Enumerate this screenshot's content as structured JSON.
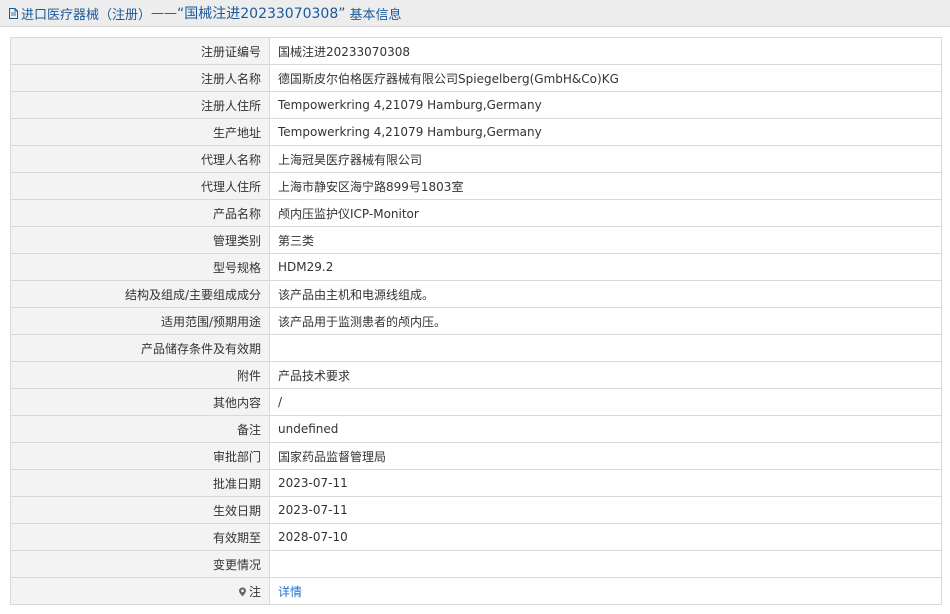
{
  "header": {
    "category": "进口医疗器械（注册）",
    "separator": "——",
    "reg_no_quoted": "“国械注进20233070308”",
    "suffix": "基本信息"
  },
  "rows": [
    {
      "label": "注册证编号",
      "value": "国械注进20233070308"
    },
    {
      "label": "注册人名称",
      "value": "德国斯皮尔伯格医疗器械有限公司Spiegelberg(GmbH&Co)KG"
    },
    {
      "label": "注册人住所",
      "value": "Tempowerkring 4,21079 Hamburg,Germany"
    },
    {
      "label": "生产地址",
      "value": "Tempowerkring 4,21079 Hamburg,Germany"
    },
    {
      "label": "代理人名称",
      "value": "上海冠昊医疗器械有限公司"
    },
    {
      "label": "代理人住所",
      "value": "上海市静安区海宁路899号1803室"
    },
    {
      "label": "产品名称",
      "value": "颅内压监护仪ICP-Monitor"
    },
    {
      "label": "管理类别",
      "value": "第三类"
    },
    {
      "label": "型号规格",
      "value": "HDM29.2"
    },
    {
      "label": "结构及组成/主要组成成分",
      "value": "该产品由主机和电源线组成。"
    },
    {
      "label": "适用范围/预期用途",
      "value": "该产品用于监测患者的颅内压。"
    },
    {
      "label": "产品储存条件及有效期",
      "value": ""
    },
    {
      "label": "附件",
      "value": "产品技术要求"
    },
    {
      "label": "其他内容",
      "value": "/"
    },
    {
      "label": "备注",
      "value": "undefined"
    },
    {
      "label": "审批部门",
      "value": "国家药品监督管理局"
    },
    {
      "label": "批准日期",
      "value": "2023-07-11"
    },
    {
      "label": "生效日期",
      "value": "2023-07-11"
    },
    {
      "label": "有效期至",
      "value": "2028-07-10"
    },
    {
      "label": "变更情况",
      "value": ""
    }
  ],
  "note": {
    "label": "注",
    "link_text": "详情"
  },
  "icons": {
    "title": "document-icon",
    "note": "map-pin-icon"
  }
}
